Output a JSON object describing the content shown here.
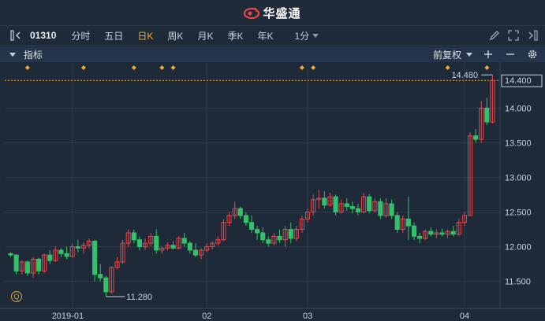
{
  "brand": {
    "name": "华盛通"
  },
  "toolbar": {
    "symbol": "01310",
    "periods": [
      "分时",
      "五日",
      "日K",
      "周K",
      "月K",
      "季K",
      "年K"
    ],
    "active_period": "日K",
    "minute_label": "1分"
  },
  "indicator_bar": {
    "label": "指标",
    "fq_label": "前复权"
  },
  "colors": {
    "up": "#e8474c",
    "down": "#33c26b",
    "accent": "#f2a93b",
    "bg": "#1e2a38"
  },
  "chart_data": {
    "type": "candlestick",
    "y_ticks": [
      "14.400",
      "14.000",
      "13.500",
      "13.000",
      "12.500",
      "12.000",
      "11.500"
    ],
    "x_labels": [
      "2019-01",
      "02",
      "03",
      "04"
    ],
    "current_price_label": "14.400",
    "max_label": "14.480",
    "min_label": "11.280",
    "ylim": [
      11.2,
      14.55
    ],
    "candles": [
      [
        11.9,
        11.92,
        11.85,
        11.88
      ],
      [
        11.88,
        11.89,
        11.6,
        11.65
      ],
      [
        11.65,
        11.8,
        11.6,
        11.78
      ],
      [
        11.78,
        11.8,
        11.58,
        11.62
      ],
      [
        11.62,
        11.85,
        11.55,
        11.82
      ],
      [
        11.82,
        11.84,
        11.6,
        11.65
      ],
      [
        11.65,
        11.9,
        11.62,
        11.88
      ],
      [
        11.88,
        11.95,
        11.75,
        11.8
      ],
      [
        11.8,
        12.0,
        11.78,
        11.95
      ],
      [
        11.95,
        11.98,
        11.85,
        11.9
      ],
      [
        11.9,
        12.0,
        11.82,
        11.86
      ],
      [
        11.86,
        12.05,
        11.84,
        12.0
      ],
      [
        12.0,
        12.1,
        11.92,
        11.98
      ],
      [
        11.98,
        12.06,
        11.9,
        12.02
      ],
      [
        12.02,
        12.12,
        11.98,
        12.08
      ],
      [
        12.08,
        12.1,
        11.5,
        11.6
      ],
      [
        11.6,
        11.75,
        11.5,
        11.55
      ],
      [
        11.55,
        11.58,
        11.28,
        11.35
      ],
      [
        11.35,
        11.72,
        11.32,
        11.7
      ],
      [
        11.7,
        11.85,
        11.68,
        11.78
      ],
      [
        11.78,
        12.1,
        11.75,
        12.05
      ],
      [
        12.05,
        12.25,
        12.0,
        12.2
      ],
      [
        12.2,
        12.25,
        12.05,
        12.1
      ],
      [
        12.1,
        12.15,
        11.95,
        12.0
      ],
      [
        12.0,
        12.12,
        11.95,
        12.05
      ],
      [
        12.05,
        12.2,
        12.0,
        12.15
      ],
      [
        12.15,
        12.25,
        11.9,
        11.95
      ],
      [
        11.95,
        12.0,
        11.9,
        11.98
      ],
      [
        11.98,
        12.06,
        11.95,
        12.02
      ],
      [
        12.02,
        12.08,
        11.96,
        11.98
      ],
      [
        11.98,
        12.15,
        11.96,
        12.12
      ],
      [
        12.12,
        12.2,
        12.0,
        12.05
      ],
      [
        12.05,
        12.08,
        11.9,
        11.95
      ],
      [
        11.95,
        12.05,
        11.85,
        11.88
      ],
      [
        11.88,
        11.98,
        11.82,
        11.95
      ],
      [
        11.95,
        12.05,
        11.92,
        12.0
      ],
      [
        12.0,
        12.08,
        11.96,
        12.05
      ],
      [
        12.05,
        12.15,
        12.02,
        12.1
      ],
      [
        12.1,
        12.4,
        12.08,
        12.35
      ],
      [
        12.35,
        12.5,
        12.3,
        12.45
      ],
      [
        12.45,
        12.65,
        12.4,
        12.55
      ],
      [
        12.55,
        12.58,
        12.4,
        12.45
      ],
      [
        12.45,
        12.5,
        12.3,
        12.35
      ],
      [
        12.35,
        12.45,
        12.2,
        12.25
      ],
      [
        12.25,
        12.3,
        12.1,
        12.2
      ],
      [
        12.2,
        12.28,
        12.05,
        12.1
      ],
      [
        12.1,
        12.15,
        12.0,
        12.05
      ],
      [
        12.05,
        12.2,
        12.02,
        12.15
      ],
      [
        12.15,
        12.25,
        12.05,
        12.1
      ],
      [
        12.1,
        12.3,
        12.0,
        12.25
      ],
      [
        12.25,
        12.35,
        12.05,
        12.12
      ],
      [
        12.12,
        12.3,
        12.08,
        12.25
      ],
      [
        12.25,
        12.45,
        12.2,
        12.4
      ],
      [
        12.4,
        12.55,
        12.35,
        12.5
      ],
      [
        12.5,
        12.75,
        12.45,
        12.68
      ],
      [
        12.68,
        12.82,
        12.55,
        12.7
      ],
      [
        12.7,
        12.8,
        12.55,
        12.6
      ],
      [
        12.6,
        12.78,
        12.58,
        12.72
      ],
      [
        12.72,
        12.75,
        12.45,
        12.5
      ],
      [
        12.5,
        12.68,
        12.48,
        12.62
      ],
      [
        12.62,
        12.7,
        12.52,
        12.58
      ],
      [
        12.58,
        12.65,
        12.48,
        12.55
      ],
      [
        12.55,
        12.62,
        12.45,
        12.5
      ],
      [
        12.5,
        12.78,
        12.48,
        12.72
      ],
      [
        12.72,
        12.76,
        12.48,
        12.52
      ],
      [
        12.52,
        12.7,
        12.5,
        12.65
      ],
      [
        12.65,
        12.7,
        12.4,
        12.45
      ],
      [
        12.45,
        12.7,
        12.42,
        12.62
      ],
      [
        12.62,
        12.68,
        12.4,
        12.45
      ],
      [
        12.45,
        12.5,
        12.2,
        12.25
      ],
      [
        12.25,
        12.45,
        12.2,
        12.4
      ],
      [
        12.4,
        12.72,
        12.1,
        12.3
      ],
      [
        12.3,
        12.35,
        12.1,
        12.15
      ],
      [
        12.15,
        12.2,
        12.05,
        12.12
      ],
      [
        12.12,
        12.25,
        12.1,
        12.22
      ],
      [
        12.22,
        12.28,
        12.15,
        12.18
      ],
      [
        12.18,
        12.25,
        12.12,
        12.2
      ],
      [
        12.2,
        12.26,
        12.15,
        12.18
      ],
      [
        12.18,
        12.25,
        12.12,
        12.22
      ],
      [
        12.22,
        12.3,
        12.15,
        12.18
      ],
      [
        12.18,
        12.4,
        12.15,
        12.35
      ],
      [
        12.35,
        12.5,
        12.3,
        12.45
      ],
      [
        12.45,
        13.65,
        12.45,
        13.6
      ],
      [
        13.6,
        13.7,
        13.5,
        13.55
      ],
      [
        13.55,
        14.1,
        13.5,
        14.0
      ],
      [
        14.0,
        14.15,
        13.75,
        13.8
      ],
      [
        13.8,
        14.48,
        13.78,
        14.4
      ]
    ],
    "markers": [
      3,
      13,
      22,
      27,
      29,
      52,
      54,
      78,
      85
    ]
  }
}
